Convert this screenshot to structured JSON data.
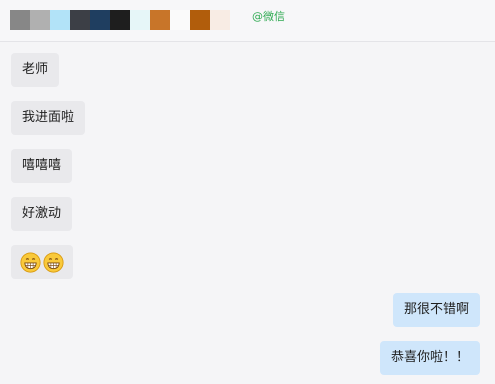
{
  "header": {
    "handle": "@微信",
    "swatch_colors": [
      "#878787",
      "#b0b0b0",
      "#b2e3f8",
      "#3c3f46",
      "#1f3e60",
      "#1e1e1e",
      "#e6f6f8",
      "#c87529",
      "#fafafa",
      "#b15d0c",
      "#f8ece4"
    ]
  },
  "messages": [
    {
      "side": "left",
      "text": "老师"
    },
    {
      "side": "left",
      "text": "我进面啦"
    },
    {
      "side": "left",
      "text": "嘻嘻嘻"
    },
    {
      "side": "left",
      "text": "好激动"
    },
    {
      "side": "left",
      "emoji": [
        "grinning-face-icon",
        "grinning-face-icon"
      ]
    },
    {
      "side": "right",
      "text": "那很不错啊"
    },
    {
      "side": "right",
      "text": "恭喜你啦！！"
    }
  ]
}
